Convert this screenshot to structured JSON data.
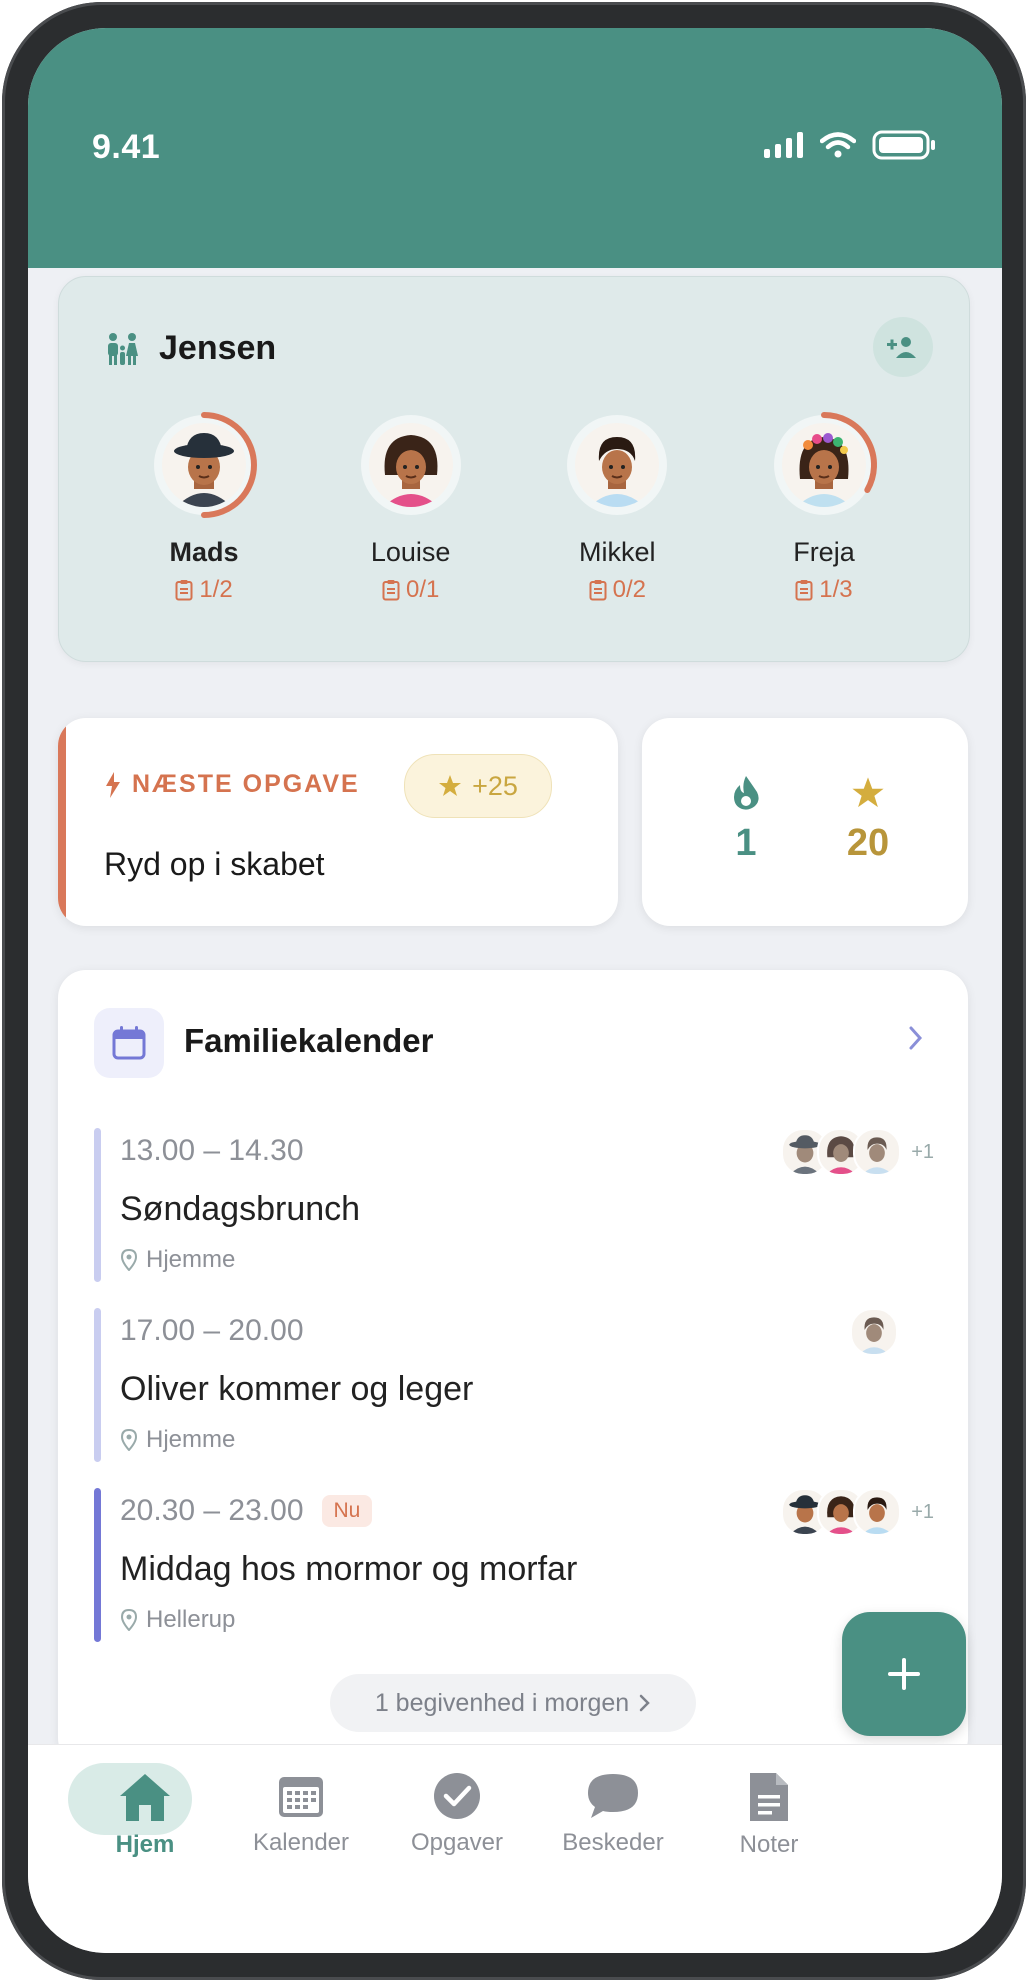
{
  "status": {
    "time": "9.41"
  },
  "family": {
    "name": "Jensen",
    "members": [
      {
        "name": "Mads",
        "tasks": "1/2",
        "progress": 0.5
      },
      {
        "name": "Louise",
        "tasks": "0/1",
        "progress": 0
      },
      {
        "name": "Mikkel",
        "tasks": "0/2",
        "progress": 0
      },
      {
        "name": "Freja",
        "tasks": "1/3",
        "progress": 0.33
      }
    ]
  },
  "next_task": {
    "label": "NÆSTE OPGAVE",
    "points": "+25",
    "title": "Ryd op i skabet"
  },
  "stats": {
    "streak": "1",
    "stars": "20"
  },
  "calendar": {
    "title": "Familiekalender",
    "events": [
      {
        "time": "13.00 – 14.30",
        "title": "Søndagsbrunch",
        "location": "Hjemme",
        "extra": "+1",
        "now": false
      },
      {
        "time": "17.00 – 20.00",
        "title": "Oliver kommer og leger",
        "location": "Hjemme",
        "extra": "",
        "now": false
      },
      {
        "time": "20.30 – 23.00",
        "title": "Middag hos mormor og morfar",
        "location": "Hellerup",
        "extra": "+1",
        "now": true,
        "badge": "Nu"
      }
    ],
    "tomorrow": "1 begivenhed i morgen"
  },
  "tabs": [
    {
      "label": "Hjem",
      "icon": "home-icon",
      "active": true
    },
    {
      "label": "Kalender",
      "icon": "calendar-icon",
      "active": false
    },
    {
      "label": "Opgaver",
      "icon": "check-circle-icon",
      "active": false
    },
    {
      "label": "Beskeder",
      "icon": "chat-bubble-icon",
      "active": false
    },
    {
      "label": "Noter",
      "icon": "note-icon",
      "active": false
    }
  ],
  "colors": {
    "primary": "#4a9083",
    "accent": "#d9785a",
    "star": "#c9a640",
    "calendar": "#7478d6"
  }
}
